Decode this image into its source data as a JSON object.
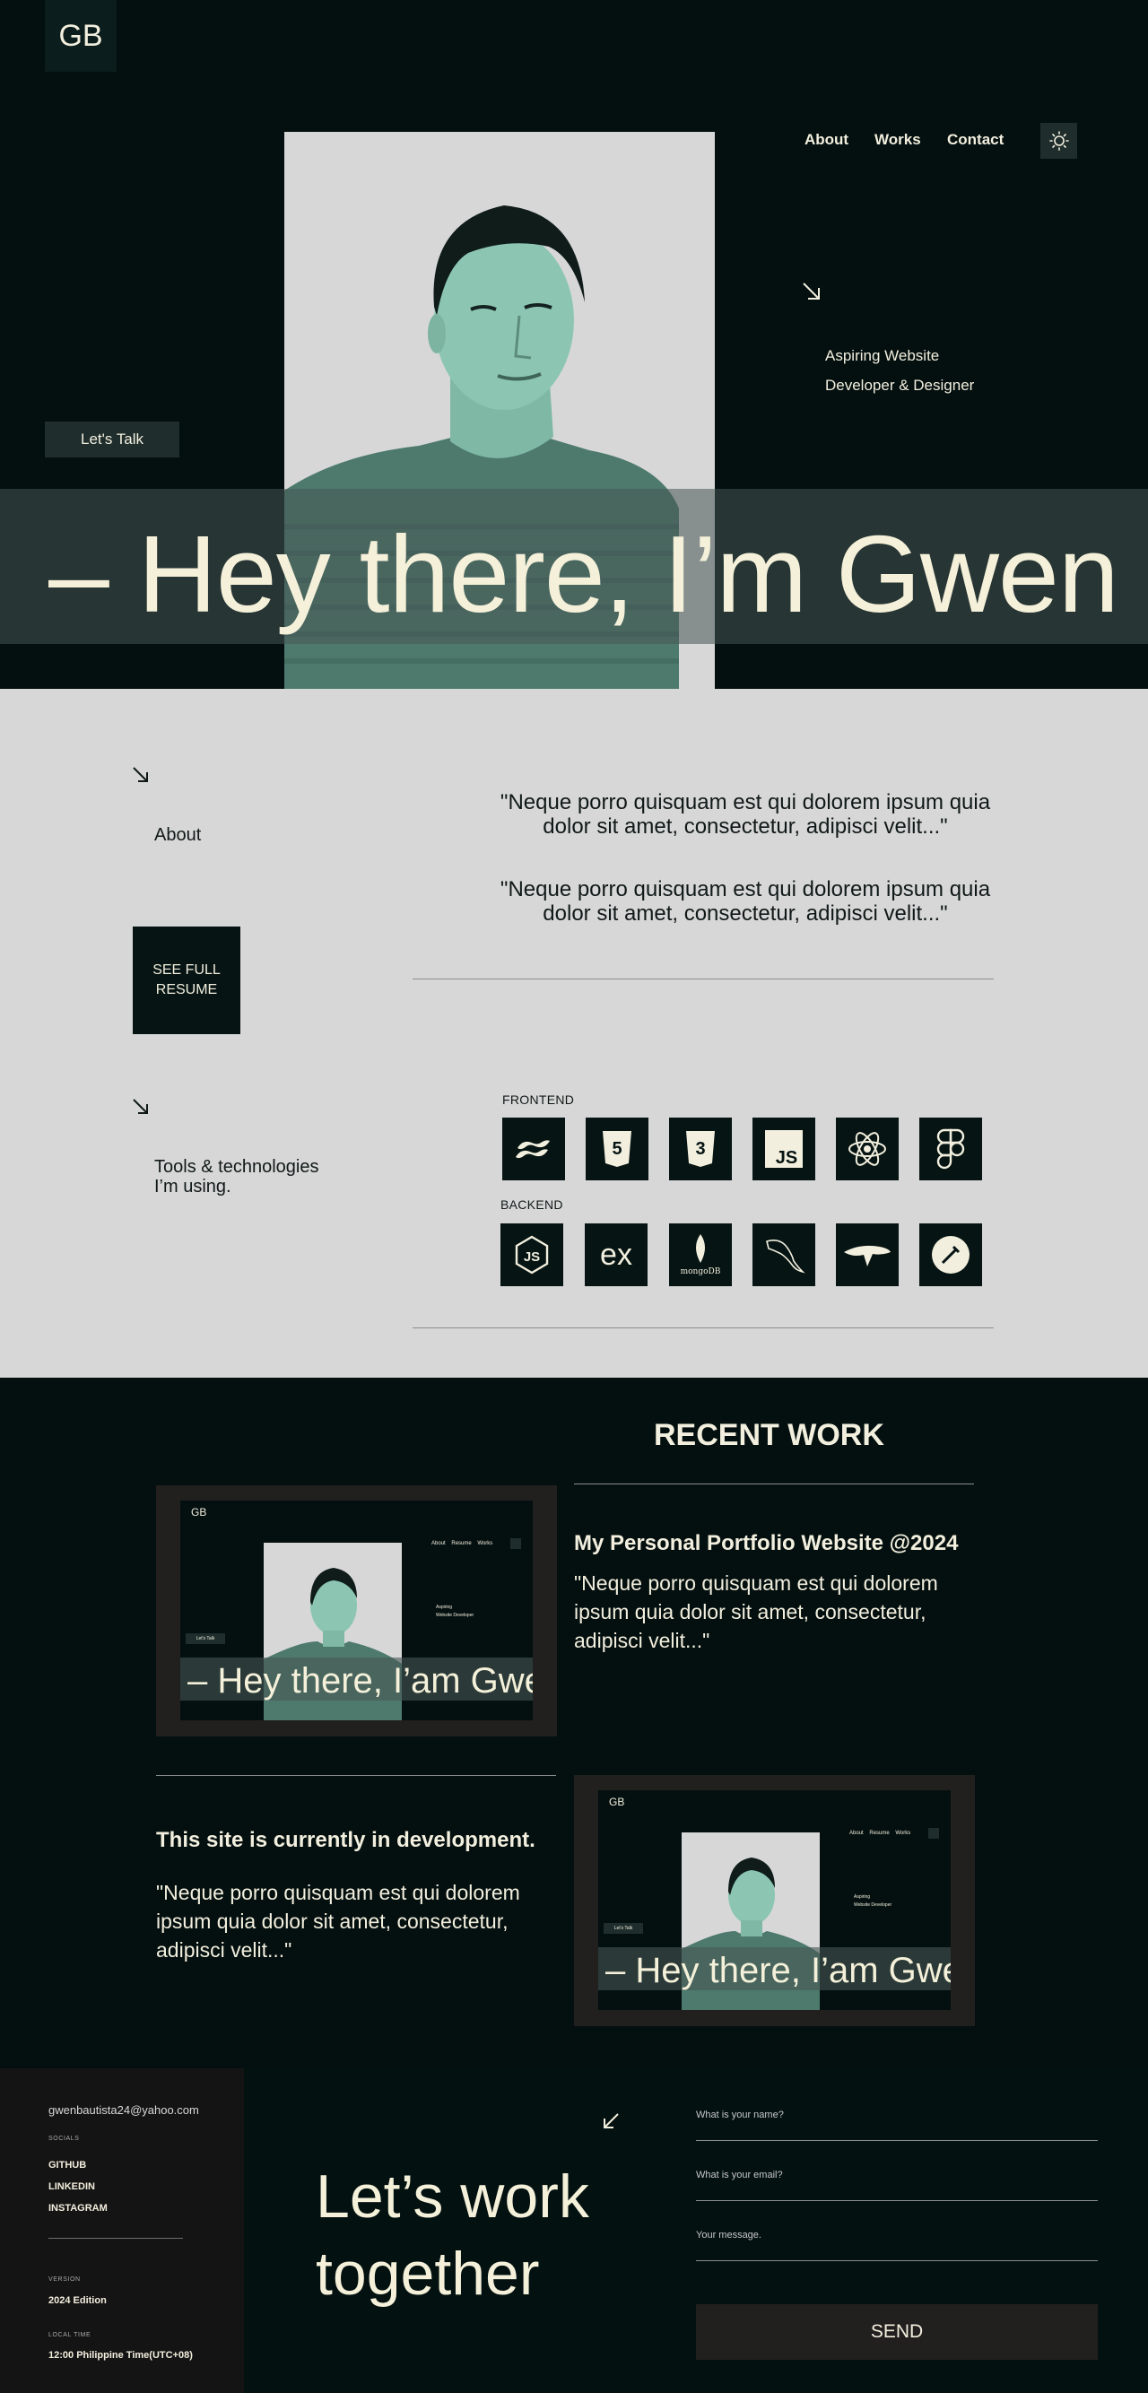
{
  "header": {
    "logo": "GB",
    "nav": [
      {
        "label": "About"
      },
      {
        "label": "Works"
      },
      {
        "label": "Contact"
      }
    ],
    "theme_icon": "sun-icon"
  },
  "hero": {
    "tagline_line1": "Aspiring Website",
    "tagline_line2": "Developer & Designer",
    "cta_label": "Let's Talk",
    "banner_text": "– Hey there, I’m Gwen"
  },
  "about": {
    "label": "About",
    "resume_line1": "SEE FULL",
    "resume_line2": "RESUME",
    "quote1": "\"Neque porro quisquam est qui dolorem ipsum quia dolor sit amet, consectetur, adipisci velit...\"",
    "quote2": "\"Neque porro quisquam est qui dolorem ipsum quia dolor sit amet, consectetur, adipisci velit...\""
  },
  "tools": {
    "label_line1": "Tools & technologies",
    "label_line2": "I’m using.",
    "frontend_label": "FRONTEND",
    "backend_label": "BACKEND",
    "frontend": [
      "tailwind-icon",
      "html5-icon",
      "css3-icon",
      "javascript-icon",
      "react-icon",
      "figma-icon"
    ],
    "backend": [
      "nodejs-icon",
      "express-icon",
      "mongodb-icon",
      "mysql-icon",
      "prisma-icon",
      "postman-icon"
    ],
    "js_text": "JS",
    "express_text": "ex",
    "mongodb_text": "mongoDB"
  },
  "works": {
    "title": "RECENT WORK",
    "project1": {
      "title": "My Personal Portfolio Website @2024",
      "desc": "\"Neque porro quisquam est qui dolorem ipsum quia dolor sit amet, consectetur, adipisci velit...\""
    },
    "project2": {
      "title": "This site is currently in development.",
      "desc": "\"Neque porro quisquam est qui dolorem ipsum quia dolor sit amet, consectetur, adipisci velit...\""
    },
    "thumb": {
      "logo": "GB",
      "nav": [
        "About",
        "Resume",
        "Works"
      ],
      "tagline_line1": "Aspiring",
      "tagline_line2": "Website Developer",
      "cta": "Let's Talk",
      "banner": "– Hey there, I’am Gwen"
    }
  },
  "footer": {
    "email": "gwenbautista24@yahoo.com",
    "socials_label": "SOCIALS",
    "socials": [
      "GITHUB",
      "LINKEDIN",
      "INSTAGRAM"
    ],
    "version_label": "VERSION",
    "version": "2024 Edition",
    "time_label": "LOCAL TIME",
    "time": "12:00 Philippine Time(UTC+08)",
    "headline_line1": "Let’s work",
    "headline_line2": "together",
    "name_placeholder": "What is your name?",
    "email_placeholder": "What is your email?",
    "message_placeholder": "Your message.",
    "send_label": "SEND"
  },
  "colors": {
    "background": "#040f0f",
    "light_section": "#d7d7d7",
    "cream_text": "#f2efde",
    "portrait_tint": "#5f9e8a",
    "button_dark": "#221f1f"
  }
}
